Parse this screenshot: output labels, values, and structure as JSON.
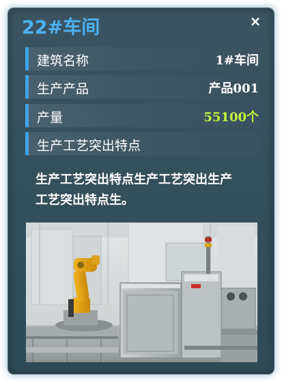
{
  "panel": {
    "title": "22#车间",
    "close_label": "×"
  },
  "rows": [
    {
      "label": "建筑名称",
      "value": "1#车间"
    },
    {
      "label": "生产产品",
      "value": "产品001"
    },
    {
      "label": "产量",
      "value": "55100个"
    },
    {
      "label": "生产工艺突出特点",
      "value": ""
    }
  ],
  "description": "生产工艺突出特点生产工艺突出生产工艺突出特点生。",
  "colors": {
    "title": "#4db2f2",
    "accent_bar": "#3ea3ea",
    "highlight_value": "#c6f53c",
    "panel_bg": "#34505d"
  },
  "photo": {
    "icon": "factory-robot-arm-image"
  }
}
